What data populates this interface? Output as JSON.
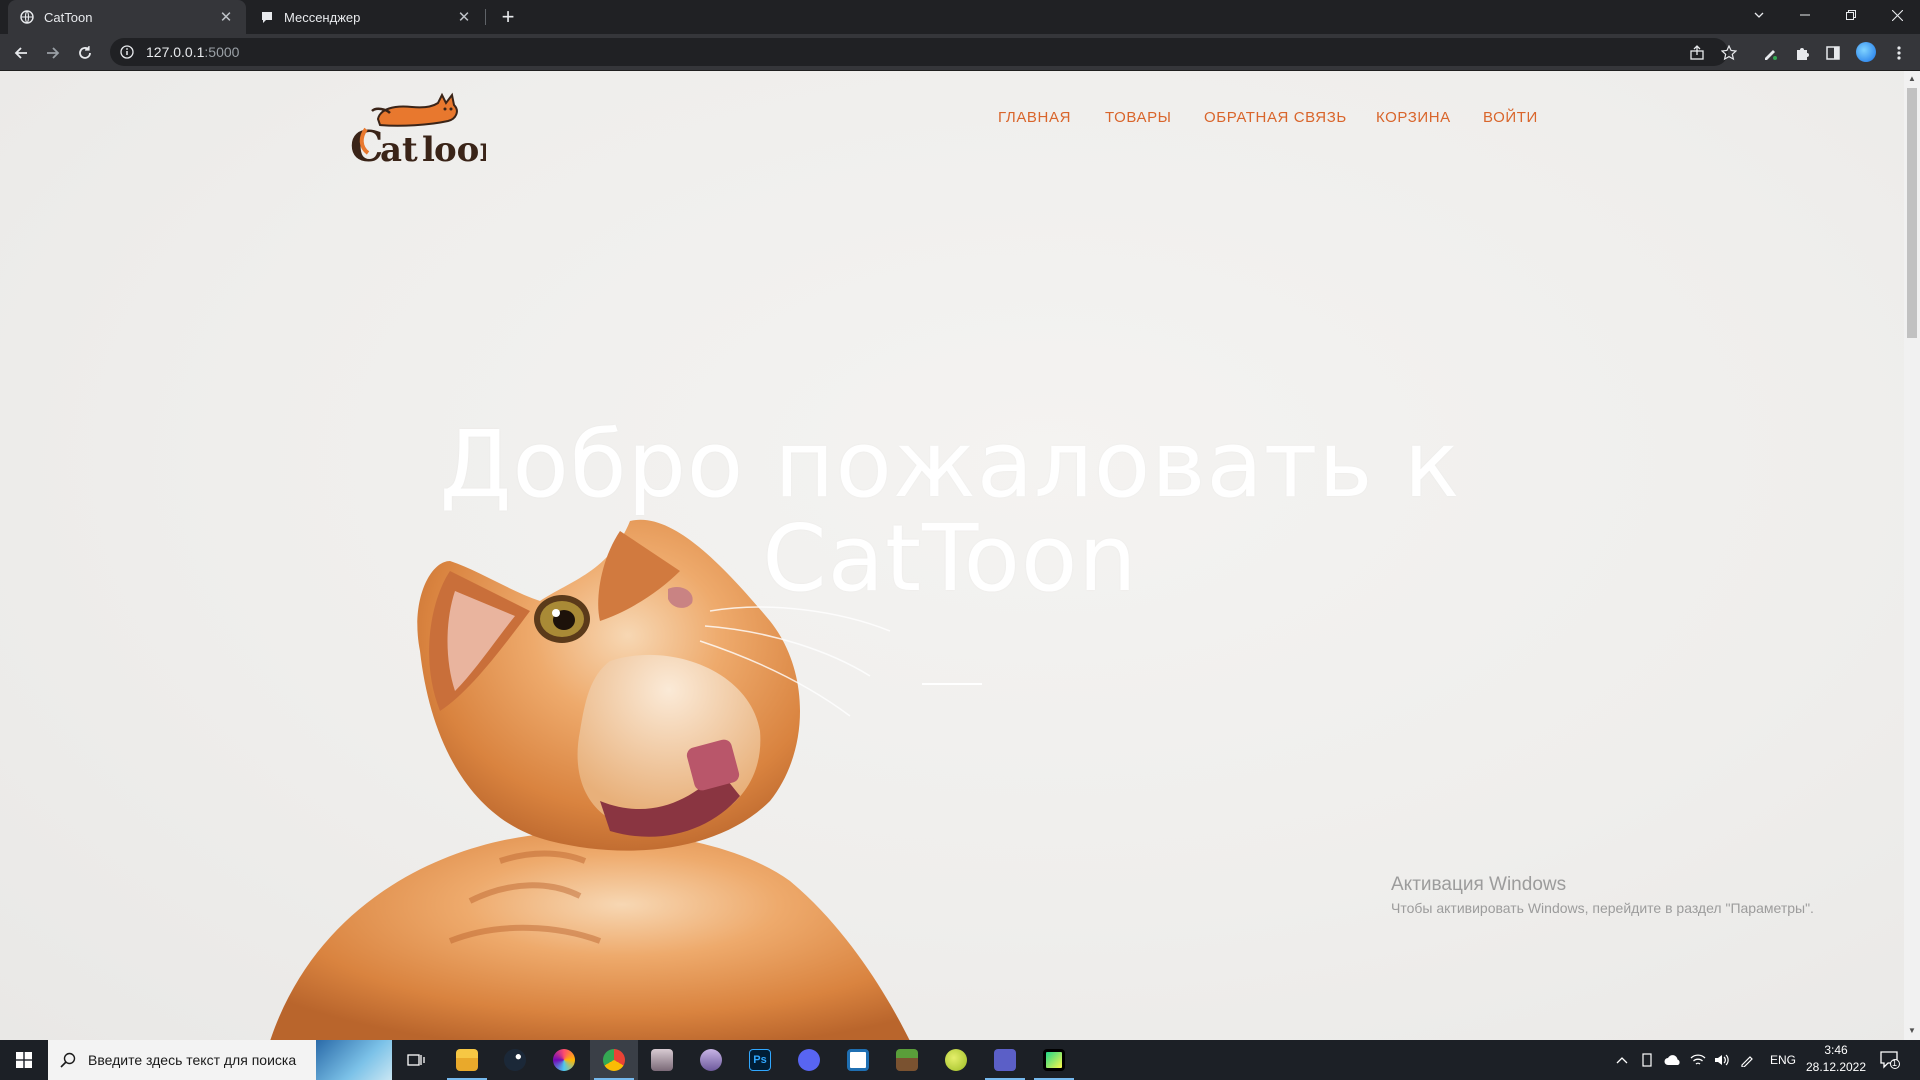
{
  "browser": {
    "tabs": [
      {
        "title": "CatToon",
        "active": true
      },
      {
        "title": "Мессенджер",
        "active": false
      }
    ],
    "url_host": "127.0.0.1",
    "url_port": ":5000"
  },
  "site": {
    "nav": [
      {
        "label": "ГЛАВНАЯ"
      },
      {
        "label": "ТОВАРЫ"
      },
      {
        "label": "ОБРАТНАЯ СВЯЗЬ"
      },
      {
        "label": "КОРЗИНА"
      },
      {
        "label": "ВОЙТИ"
      }
    ],
    "logo_text": "Catloon",
    "hero_line1": "Добро пожаловать к",
    "hero_line2": "CatToon",
    "accent_color": "#d9652b"
  },
  "watermark": {
    "title": "Активация Windows",
    "subtitle": "Чтобы активировать Windows, перейдите в раздел \"Параметры\"."
  },
  "taskbar": {
    "search_placeholder": "Введите здесь текст для поиска",
    "language": "ENG",
    "time": "3:46",
    "date": "28.12.2022",
    "notification_count": "1"
  }
}
